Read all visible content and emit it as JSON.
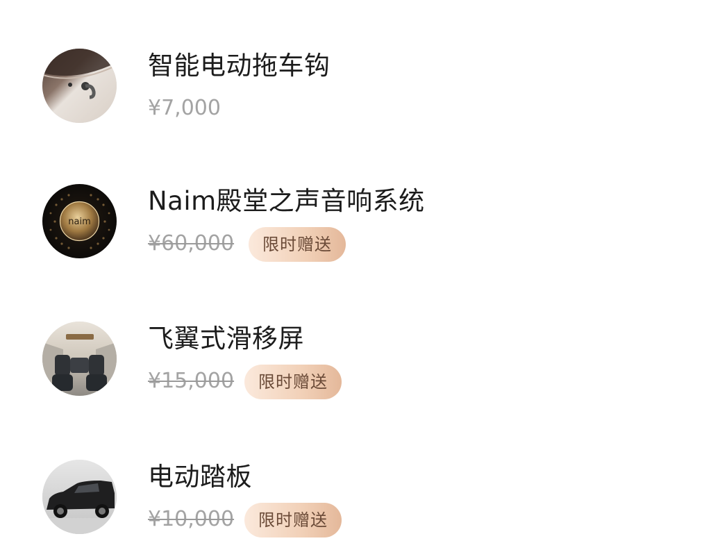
{
  "items": [
    {
      "name": "智能电动拖车钩",
      "price": "¥7,000",
      "badge": "",
      "image": "tow-hook-image"
    },
    {
      "name": "Naim殿堂之声音响系统",
      "price": "¥60,000",
      "badge": "限时赠送",
      "image": "speaker-image",
      "logo_text": "naim"
    },
    {
      "name": "飞翼式滑移屏",
      "price": "¥15,000",
      "badge": "限时赠送",
      "image": "car-interior-image"
    },
    {
      "name": "电动踏板",
      "price": "¥10,000",
      "badge": "限时赠送",
      "image": "car-side-image"
    }
  ],
  "colors": {
    "title": "#1c1c1c",
    "price": "#a3a3a3",
    "badge_bg_start": "#fbe9dc",
    "badge_bg_end": "#e4b89a",
    "badge_text": "#6a4a37"
  }
}
